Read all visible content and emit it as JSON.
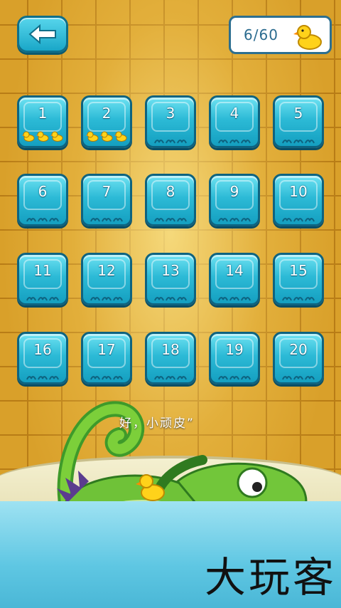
{
  "header": {
    "back_icon": "left-arrow-icon",
    "score": "6/60",
    "score_icon": "rubber-duck-icon"
  },
  "levels": [
    {
      "num": "1",
      "ducks": 3
    },
    {
      "num": "2",
      "ducks": 3
    },
    {
      "num": "3",
      "ducks": 0
    },
    {
      "num": "4",
      "ducks": 0
    },
    {
      "num": "5",
      "ducks": 0
    },
    {
      "num": "6",
      "ducks": 0
    },
    {
      "num": "7",
      "ducks": 0
    },
    {
      "num": "8",
      "ducks": 0
    },
    {
      "num": "9",
      "ducks": 0
    },
    {
      "num": "10",
      "ducks": 0
    },
    {
      "num": "11",
      "ducks": 0
    },
    {
      "num": "12",
      "ducks": 0
    },
    {
      "num": "13",
      "ducks": 0
    },
    {
      "num": "14",
      "ducks": 0
    },
    {
      "num": "15",
      "ducks": 0
    },
    {
      "num": "16",
      "ducks": 0
    },
    {
      "num": "17",
      "ducks": 0
    },
    {
      "num": "18",
      "ducks": 0
    },
    {
      "num": "19",
      "ducks": 0
    },
    {
      "num": "20",
      "ducks": 0
    }
  ],
  "scene": {
    "speech": "好，小顽皮”",
    "character": "crocodile-in-bathtub"
  },
  "watermark": "大玩客",
  "colors": {
    "tile_bg": "#d9a02a",
    "button_blue": "#2cbad6",
    "duck_yellow": "#ffd21a"
  }
}
